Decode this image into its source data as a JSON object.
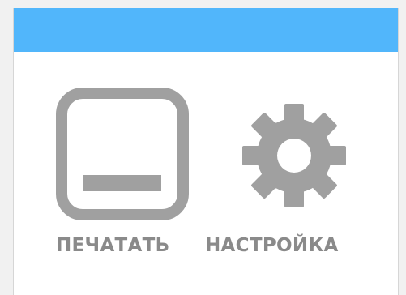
{
  "colors": {
    "titlebar": "#51b6fb",
    "icon": "#a0a0a0",
    "label": "#8a8a8a",
    "window_bg": "#ffffff"
  },
  "tiles": [
    {
      "label": "ПЕЧАТАТЬ",
      "icon": "printer-tray-icon"
    },
    {
      "label": "НАСТРОЙКА",
      "icon": "gear-icon"
    }
  ]
}
